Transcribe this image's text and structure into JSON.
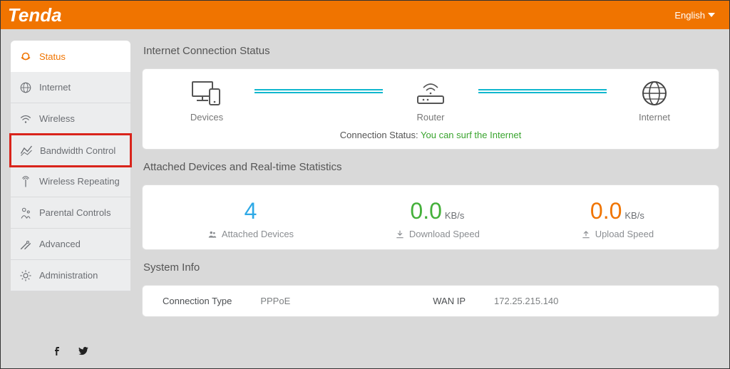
{
  "brand": "Tenda",
  "language": "English",
  "sidebar": {
    "items": [
      {
        "label": "Status"
      },
      {
        "label": "Internet"
      },
      {
        "label": "Wireless"
      },
      {
        "label": "Bandwidth Control"
      },
      {
        "label": "Wireless Repeating"
      },
      {
        "label": "Parental Controls"
      },
      {
        "label": "Advanced"
      },
      {
        "label": "Administration"
      }
    ]
  },
  "sections": {
    "connection": {
      "title": "Internet Connection Status",
      "nodes": {
        "devices": "Devices",
        "router": "Router",
        "internet": "Internet"
      },
      "status_label": "Connection Status:",
      "status_value": "You can surf the Internet"
    },
    "stats": {
      "title": "Attached Devices and Real-time Statistics",
      "attached_value": "4",
      "attached_label": "Attached Devices",
      "download_value": "0.0",
      "download_unit": "KB/s",
      "download_label": "Download Speed",
      "upload_value": "0.0",
      "upload_unit": "KB/s",
      "upload_label": "Upload Speed"
    },
    "sysinfo": {
      "title": "System Info",
      "conn_type_label": "Connection Type",
      "conn_type_value": "PPPoE",
      "wan_ip_label": "WAN IP",
      "wan_ip_value": "172.25.215.140"
    }
  }
}
